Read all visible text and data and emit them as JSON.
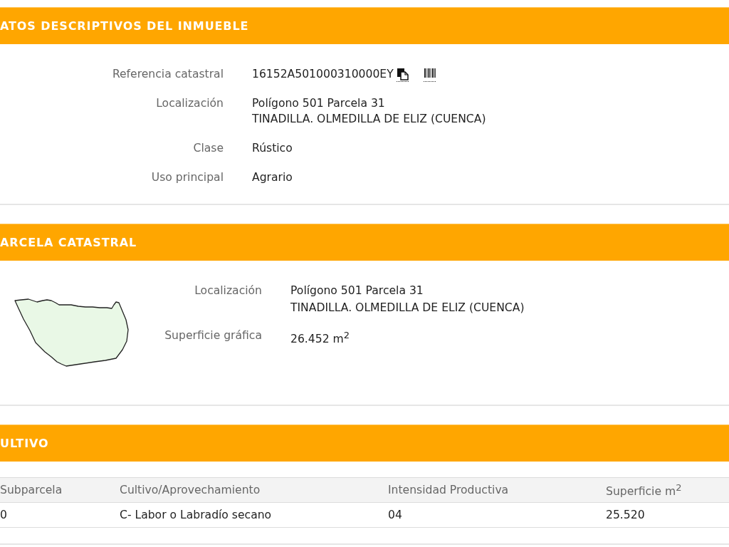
{
  "property_details": {
    "title": "ATOS DESCRIPTIVOS DEL INMUEBLE",
    "fields": [
      {
        "kind": "reference",
        "label": "Referencia catastral",
        "lines": [
          "16152A501000310000EY"
        ]
      },
      {
        "kind": "text",
        "label": "Localización",
        "lines": [
          "Polígono 501 Parcela 31",
          "TINADILLA. OLMEDILLA DE ELIZ (CUENCA)"
        ]
      },
      {
        "kind": "text",
        "label": "Clase",
        "lines": [
          "Rústico"
        ]
      },
      {
        "kind": "text",
        "label": "Uso principal",
        "lines": [
          "Agrario"
        ]
      }
    ]
  },
  "parcel": {
    "title": "ARCELA CATASTRAL",
    "fields": [
      {
        "kind": "text",
        "label": "Localización",
        "lines": [
          "Polígono 501 Parcela 31",
          "TINADILLA. OLMEDILLA DE ELIZ (CUENCA)"
        ]
      },
      {
        "kind": "text",
        "label": "Superficie gráfica",
        "lines": [
          "26.452 m$^{2}$"
        ]
      }
    ]
  },
  "crops": {
    "title": "ULTIVO",
    "table": {
      "columns": [
        "Subparcela",
        "Cultivo/Aprovechamiento",
        "Intensidad Productiva",
        "Superficie m$^{2}$"
      ],
      "rows": [
        [
          "0",
          "C- Labor o Labradío secano",
          "04",
          "25.520"
        ]
      ]
    }
  }
}
